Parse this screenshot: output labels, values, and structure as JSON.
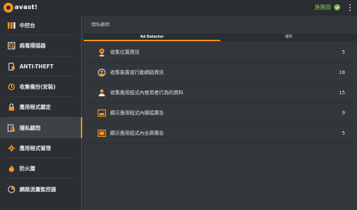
{
  "app": {
    "logo_text": "avast!",
    "status_label": "進階版"
  },
  "sidebar": {
    "items": [
      {
        "label": "中控台",
        "icon": "dashboard-icon"
      },
      {
        "label": "病毒掃描器",
        "icon": "scan-icon"
      },
      {
        "label": "ANTI-THEFT",
        "icon": "phone-lock-icon"
      },
      {
        "label": "收集備份(安裝)",
        "icon": "backup-icon"
      },
      {
        "label": "應用程式鎖定",
        "icon": "lock-icon"
      },
      {
        "label": "隱私顧問",
        "icon": "privacy-icon"
      },
      {
        "label": "應用程式管理",
        "icon": "gear-icon"
      },
      {
        "label": "防火牆",
        "icon": "flame-icon"
      },
      {
        "label": "網路流量監控器",
        "icon": "network-icon"
      }
    ],
    "active_index": 5
  },
  "main": {
    "title": "隱私顧問",
    "tabs": [
      {
        "label": "Ad Detector"
      },
      {
        "label": "權限"
      }
    ],
    "rows": [
      {
        "label": "收集位置資訊",
        "count": "5",
        "icon": "location-icon"
      },
      {
        "label": "收集裝置或行動網路資訊",
        "count": "18",
        "icon": "network-info-icon"
      },
      {
        "label": "收集應用程式內使用者行為的資料",
        "count": "15",
        "icon": "user-behavior-icon"
      },
      {
        "label": "顯示應用程式內橫幅廣告",
        "count": "9",
        "icon": "banner-ad-icon"
      },
      {
        "label": "顯示應用程式內全屏廣告",
        "count": "5",
        "icon": "fullscreen-ad-icon"
      }
    ]
  },
  "colors": {
    "accent": "#f7941d",
    "status_green": "#7cb342"
  }
}
